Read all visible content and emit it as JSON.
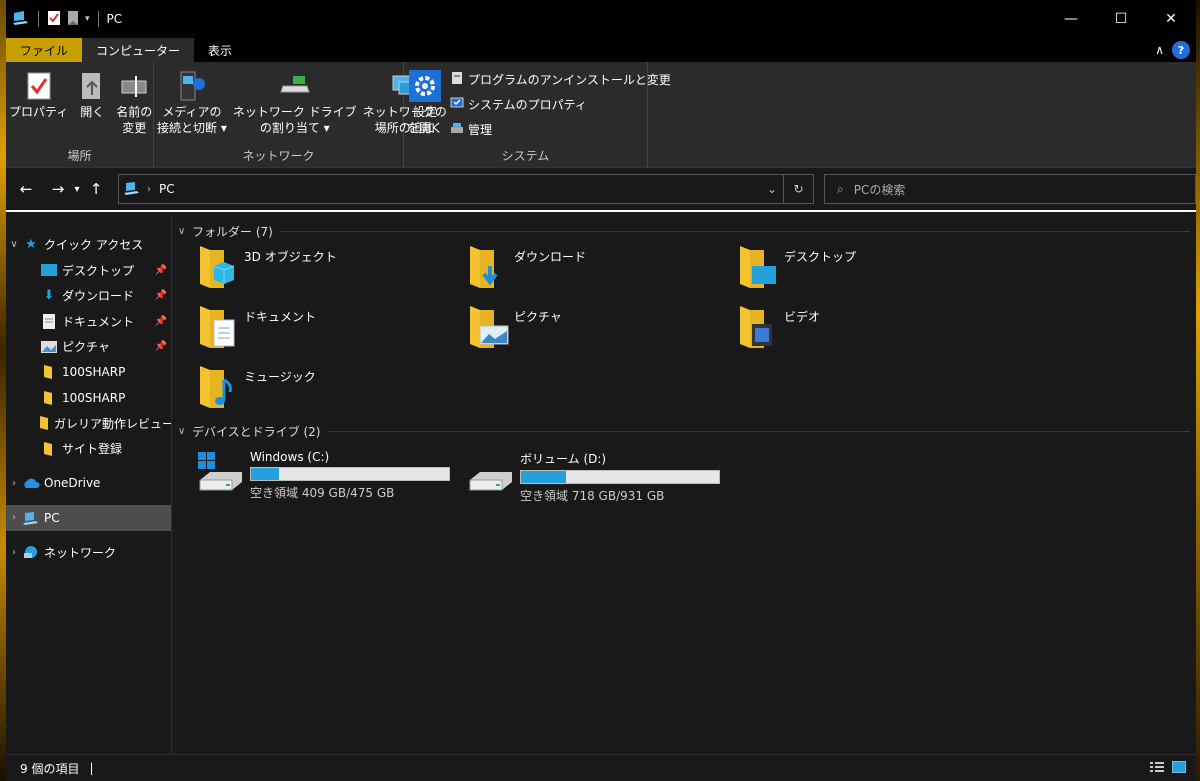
{
  "window": {
    "title": "PC"
  },
  "ribbon_tabs": [
    {
      "label": "ファイル"
    },
    {
      "label": "コンピューター"
    },
    {
      "label": "表示"
    }
  ],
  "ribbon": {
    "location": {
      "name": "場所",
      "properties": "プロパティ",
      "open": "開く",
      "rename_line1": "名前の",
      "rename_line2": "変更"
    },
    "network": {
      "name": "ネットワーク",
      "media_line1": "メディアの",
      "media_line2": "接続と切断",
      "map_drive_line1": "ネットワーク ドライブ",
      "map_drive_line2": "の割り当て",
      "add_location_line1": "ネットワークの",
      "add_location_line2": "場所の追加"
    },
    "system": {
      "name": "システム",
      "settings_line1": "設定",
      "settings_line2": "を開く",
      "uninstall": "プログラムのアンインストールと変更",
      "system_properties": "システムのプロパティ",
      "manage": "管理"
    }
  },
  "address": {
    "path": "PC",
    "search_placeholder": "PCの検索"
  },
  "sidebar": {
    "quick_access": "クイック アクセス",
    "items": [
      {
        "label": "デスクトップ"
      },
      {
        "label": "ダウンロード"
      },
      {
        "label": "ドキュメント"
      },
      {
        "label": "ピクチャ"
      },
      {
        "label": "100SHARP"
      },
      {
        "label": "100SHARP"
      },
      {
        "label": "ガレリア動作レビュー資"
      },
      {
        "label": "サイト登録"
      }
    ],
    "onedrive": "OneDrive",
    "pc": "PC",
    "network": "ネットワーク"
  },
  "folders_section": {
    "title": "フォルダー (7)",
    "items": [
      {
        "label": "3D オブジェクト"
      },
      {
        "label": "ダウンロード"
      },
      {
        "label": "デスクトップ"
      },
      {
        "label": "ドキュメント"
      },
      {
        "label": "ピクチャ"
      },
      {
        "label": "ビデオ"
      },
      {
        "label": "ミュージック"
      }
    ]
  },
  "drives_section": {
    "title": "デバイスとドライブ (2)",
    "items": [
      {
        "name": "Windows (C:)",
        "free": "空き領域 409 GB/475 GB",
        "used_fraction": 0.139
      },
      {
        "name": "ボリューム (D:)",
        "free": "空き領域 718 GB/931 GB",
        "used_fraction": 0.229
      }
    ]
  },
  "status": {
    "count": "9 個の項目"
  },
  "colors": {
    "file_tab": "#c7a000",
    "accent": "#26a0da",
    "folder": "#f4c430"
  }
}
